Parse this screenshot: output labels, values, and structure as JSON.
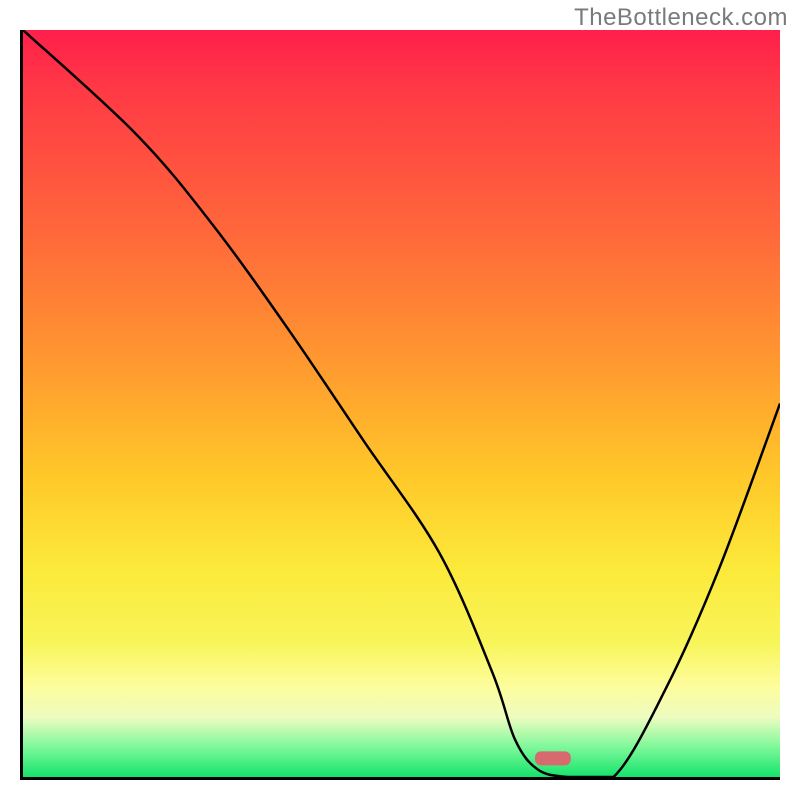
{
  "watermark": "TheBottleneck.com",
  "chart_data": {
    "type": "line",
    "title": "",
    "xlabel": "",
    "ylabel": "",
    "xlim": [
      0,
      100
    ],
    "ylim": [
      0,
      100
    ],
    "grid": false,
    "series": [
      {
        "name": "curve",
        "x": [
          0,
          15,
          25,
          35,
          45,
          55,
          62,
          65,
          68,
          72,
          78,
          85,
          92,
          100
        ],
        "values": [
          100,
          86,
          74,
          60,
          45,
          30,
          14,
          5,
          1,
          0,
          0,
          12,
          28,
          50
        ]
      }
    ],
    "marker": {
      "x": 70,
      "y": 2.5,
      "color": "#d66a6f"
    },
    "background_gradient": {
      "stops": [
        {
          "pos": 0,
          "color": "#ff1f4b"
        },
        {
          "pos": 8,
          "color": "#ff3945"
        },
        {
          "pos": 28,
          "color": "#ff6a3a"
        },
        {
          "pos": 45,
          "color": "#ff9a2f"
        },
        {
          "pos": 60,
          "color": "#ffc929"
        },
        {
          "pos": 72,
          "color": "#fce93a"
        },
        {
          "pos": 82,
          "color": "#f8f559"
        },
        {
          "pos": 88,
          "color": "#fdfd9e"
        },
        {
          "pos": 92,
          "color": "#eefcc0"
        },
        {
          "pos": 96,
          "color": "#7ef89a"
        },
        {
          "pos": 100,
          "color": "#15e36b"
        }
      ]
    }
  }
}
